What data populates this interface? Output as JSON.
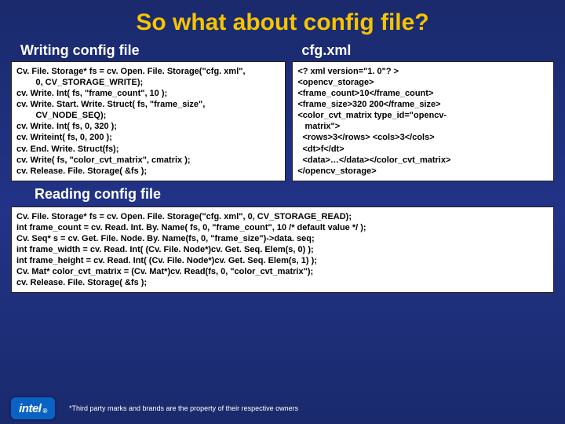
{
  "title": "So what about config file?",
  "headings": {
    "writing": "Writing config file",
    "xml": "cfg.xml",
    "reading": "Reading config file"
  },
  "writing_code": [
    "Cv. File. Storage* fs = cv. Open. File. Storage(\"cfg. xml\",",
    "        0, CV_STORAGE_WRITE);",
    "cv. Write. Int( fs, \"frame_count\", 10 );",
    "cv. Write. Start. Write. Struct( fs, \"frame_size\",",
    "        CV_NODE_SEQ);",
    "cv. Write. Int( fs, 0, 320 );",
    "cv. Writeint( fs, 0, 200 );",
    "cv. End. Write. Struct(fs);",
    "cv. Write( fs, \"color_cvt_matrix\", cmatrix );",
    "cv. Release. File. Storage( &fs );"
  ],
  "xml_code": [
    "<? xml version=\"1. 0\"? >",
    "<opencv_storage>",
    "<frame_count>10</frame_count>",
    "<frame_size>320 200</frame_size>",
    "<color_cvt_matrix type_id=\"opencv-",
    "   matrix\">",
    "  <rows>3</rows> <cols>3</cols>",
    "  <dt>f</dt>",
    "  <data>…</data></color_cvt_matrix>",
    "</opencv_storage>"
  ],
  "reading_code": [
    "Cv. File. Storage* fs = cv. Open. File. Storage(\"cfg. xml\", 0, CV_STORAGE_READ);",
    "int frame_count = cv. Read. Int. By. Name( fs, 0, \"frame_count\", 10 /* default value */ );",
    "Cv. Seq* s = cv. Get. File. Node. By. Name(fs, 0, \"frame_size\")->data. seq;",
    "int frame_width = cv. Read. Int( (Cv. File. Node*)cv. Get. Seq. Elem(s, 0) );",
    "int frame_height = cv. Read. Int( (Cv. File. Node*)cv. Get. Seq. Elem(s, 1) );",
    "Cv. Mat* color_cvt_matrix = (Cv. Mat*)cv. Read(fs, 0, \"color_cvt_matrix\");",
    "cv. Release. File. Storage( &fs );"
  ],
  "logo": "intel",
  "footnote": "*Third party marks and brands are the property of their respective owners"
}
